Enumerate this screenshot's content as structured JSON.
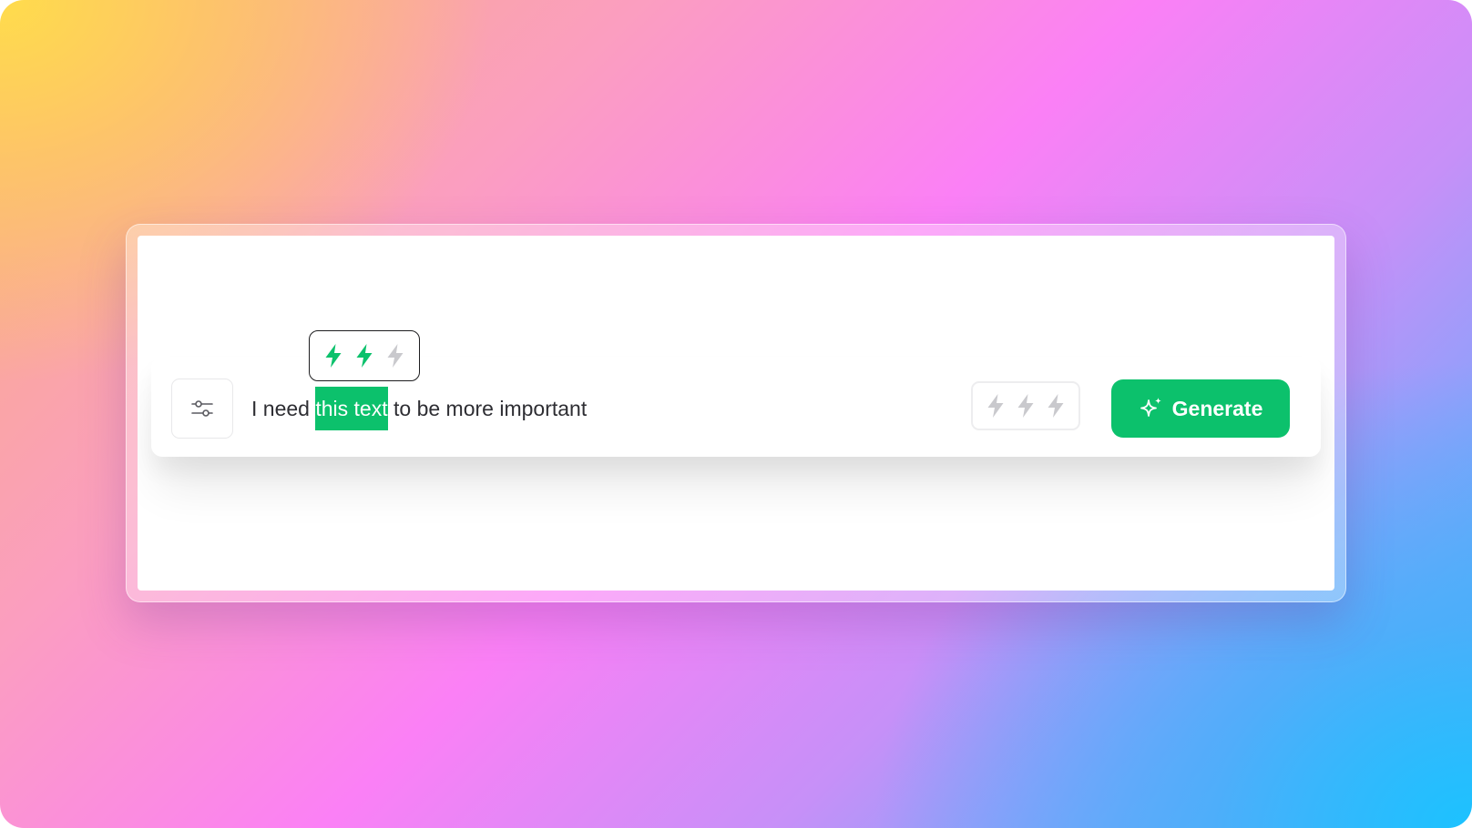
{
  "prompt": {
    "text_before": "I need ",
    "highlighted_text": "this text",
    "text_after": " to be more important"
  },
  "highlight_rating": {
    "level": 2,
    "max": 3,
    "icon": "bolt-icon"
  },
  "prompt_rating": {
    "level": 0,
    "max": 3,
    "icon": "bolt-icon"
  },
  "settings_button": {
    "icon": "sliders-icon"
  },
  "generate_button": {
    "label": "Generate",
    "icon": "sparkle-icon"
  },
  "colors": {
    "accent": "#0cc16c",
    "bolt_inactive": "#c9c9cd",
    "text": "#2e2e33"
  }
}
